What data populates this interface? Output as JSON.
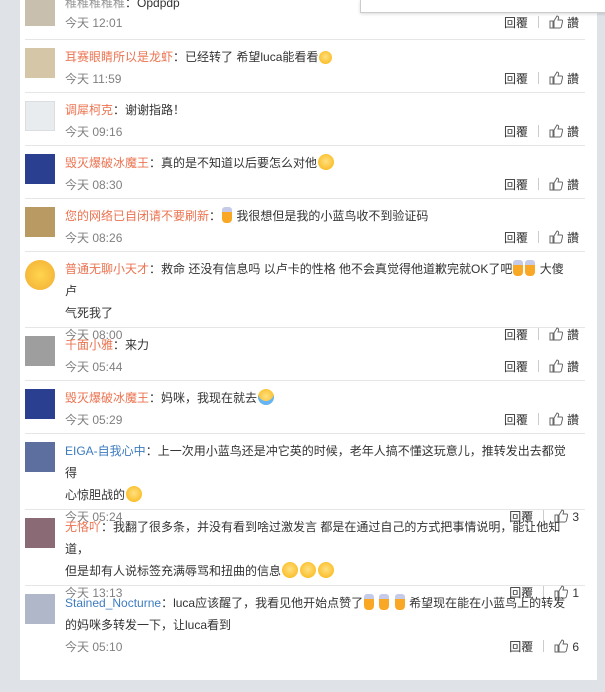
{
  "actions": {
    "reply": "回覆",
    "like_label": "讚"
  },
  "comments": [
    {
      "user": "",
      "text": "Opdpdp",
      "time": "今天 12:01",
      "likes": "",
      "avatar_color": "#c9bfae",
      "user_color": "orange",
      "partial": true
    },
    {
      "user": "耳赛眼睛所以是龙虾",
      "text": "已经转了 希望luca能看看",
      "time": "今天 11:59",
      "likes": "",
      "avatar_color": "#d6c6a8",
      "user_color": "orange"
    },
    {
      "user": "调犀柯克",
      "text": "谢谢指路！",
      "time": "今天 09:16",
      "likes": "",
      "avatar_color": "#e8ecef",
      "user_color": "orange"
    },
    {
      "user": "毁灭爆破冰魔王",
      "text": "真的是不知道以后要怎么对他",
      "time": "今天 08:30",
      "likes": "",
      "avatar_color": "#2a3f8f",
      "user_color": "orange"
    },
    {
      "user": "您的网络已自闭请不要刷新",
      "text": "我很想但是我的小蓝鸟收不到验证码",
      "time": "今天 08:26",
      "likes": "",
      "avatar_color": "#b89a62",
      "user_color": "orange"
    },
    {
      "user": "普通无聊小天才",
      "text": "救命 还没有信息吗 以卢卡的性格 他不会真觉得他道歉完就OK了吧",
      "text2": "大傻卢",
      "text3": "气死我了",
      "time": "今天 08:00",
      "likes": "",
      "avatar_color": "#f6b93b",
      "user_color": "orange"
    },
    {
      "user": "千面小雅",
      "text": "来力",
      "time": "今天 05:44",
      "likes": "",
      "avatar_color": "#9e9e9e",
      "user_color": "orange"
    },
    {
      "user": "毁灭爆破冰魔王",
      "text": "妈咪，我现在就去",
      "time": "今天 05:29",
      "likes": "",
      "avatar_color": "#2a3f8f",
      "user_color": "orange"
    },
    {
      "user": "EIGA-自我心中",
      "text": "上一次用小蓝鸟还是冲它英的时候，老年人搞不懂这玩意儿，推转发出去都觉得",
      "text2": "心惊胆战的",
      "time": "今天 05:24",
      "likes": "3",
      "avatar_color": "#5c6f9e",
      "user_color": "orange"
    },
    {
      "user": "无恪吖",
      "text": "我翻了很多条，并没有看到啥过激发言 都是在通过自己的方式把事情说明，能让他知道，",
      "text2": "但是却有人说标签充满辱骂和扭曲的信息",
      "time": "今天 13:13",
      "likes": "1",
      "avatar_color": "#8a6a74",
      "user_color": "orange"
    },
    {
      "user": "Stained_Nocturne",
      "text": "luca应该醒了，我看见他开始点赞了",
      "text2": "希望现在能在小蓝鸟上的转发",
      "text3": "的妈咪多转发一下，让luca看到",
      "time": "今天 05:10",
      "likes": "6",
      "avatar_color": "#b0b7c9",
      "user_color": "orange"
    }
  ]
}
